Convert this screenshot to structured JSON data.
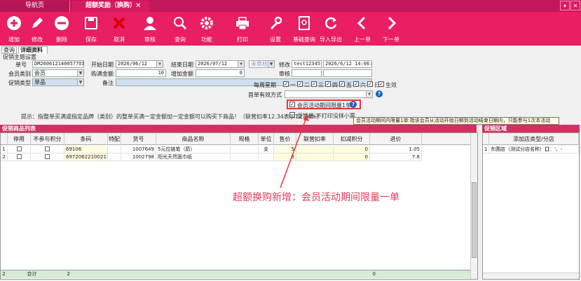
{
  "tabs": {
    "home": "导航页",
    "active": "超额奖励（换购）"
  },
  "toolbar": [
    {
      "id": "add",
      "label": "增加",
      "icon": "plus-circle-icon"
    },
    {
      "id": "edit",
      "label": "修改",
      "icon": "pencil-icon"
    },
    {
      "id": "delete",
      "label": "删除",
      "icon": "minus-circle-icon"
    },
    {
      "id": "save",
      "label": "保存",
      "icon": "floppy-disk-icon"
    },
    {
      "id": "cancel",
      "label": "取消",
      "icon": "x-mark-icon"
    },
    {
      "id": "audit",
      "label": "审核",
      "icon": "user-icon"
    },
    {
      "id": "query",
      "label": "查询",
      "icon": "magnifier-icon"
    },
    {
      "id": "func",
      "label": "功能",
      "icon": "gear-icon"
    },
    {
      "id": "print",
      "label": "打印",
      "icon": "printer-icon"
    },
    {
      "id": "settings",
      "label": "设置",
      "icon": "wrench-icon"
    },
    {
      "id": "promo_query",
      "label": "基础查询",
      "icon": "document-search-icon"
    },
    {
      "id": "import",
      "label": "导入导出",
      "icon": "refresh-icon"
    },
    {
      "id": "prev",
      "label": "上一单",
      "icon": "chevron-left-icon"
    },
    {
      "id": "next",
      "label": "下一单",
      "icon": "chevron-right-icon"
    }
  ],
  "subtabs": {
    "query": "查询",
    "detail": "详细资料"
  },
  "form": {
    "section": "促销主题设置",
    "order_no_label": "单号",
    "order_no": "DM2606121400577O188",
    "start_date_label": "开始日期",
    "start_date": "2026/06/12",
    "end_date_label": "结束日期",
    "end_date": "2026/07/12",
    "audit_status": "未审核",
    "modify_label": "修改",
    "modify_user": "test12345",
    "modify_time": "2026/6/12 14:06:37",
    "member_type_label": "会员类别",
    "member_type": "会员",
    "buy_amount_label": "购满金额",
    "buy_amount": "10",
    "add_amount_label": "增加金额",
    "add_amount": "0",
    "audit_label": "审核",
    "promo_type_label": "促销类型",
    "promo_type": "单品",
    "note_label": "备注",
    "weekly_label": "每周星期",
    "weekdays": [
      "一",
      "二",
      "三",
      "四",
      "五",
      "六",
      "日"
    ],
    "effective_label": "生效",
    "first_valid_label": "首单有效方式",
    "member_limit_label": "会员活动期间限量1单",
    "integer_label": "促销量-不打印没抹小票",
    "hint": "提示：指整单买满或指定品牌（类别）的整单买满一定金额加一定金额可以购买下商品！（联营扣率12.34表示12.34%）",
    "tooltip": "会员活动期间内限量1单:指该会员从活动开始日期到活动结束日期内，只能参与1次本活动"
  },
  "products": {
    "title": "促销商品列表",
    "columns": [
      "停用",
      "不参与积分",
      "条码",
      "特配",
      "货号",
      "商品名称",
      "规格",
      "单位",
      "售价",
      "联营扣率",
      "扣减积分",
      "进价"
    ],
    "rows": [
      {
        "no": "1",
        "barcode": "69106",
        "item": "1007649",
        "name": "5元拉链笔（箭）",
        "spec": "",
        "unit": "支",
        "price": "5",
        "rate": "",
        "points": "0",
        "cost": "1.05"
      },
      {
        "no": "2",
        "barcode": "6972062210021",
        "item": "1002798",
        "name": "阳光天然面巾纸",
        "spec": "",
        "unit": "",
        "price": "8",
        "rate": "",
        "points": "0",
        "cost": "7.8"
      }
    ],
    "footer": {
      "no": "2",
      "label": "合计",
      "count": "2",
      "points": "0"
    }
  },
  "branches": {
    "title": "促销区域",
    "column": "添加店类型/分店",
    "rows": [
      {
        "no": "1",
        "text": "东圃店（测试分店名称）【】：'、-"
      }
    ]
  },
  "annotation": "超额换购新增：会员活动期间限量一单",
  "colors": {
    "brand": "#e91e63",
    "annotation": "#e5395e",
    "highlight": "#e53935"
  }
}
